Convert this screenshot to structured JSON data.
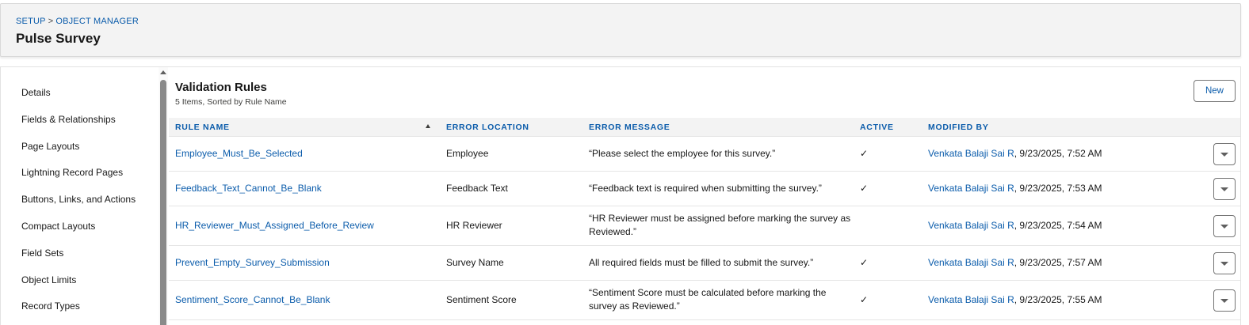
{
  "breadcrumb": {
    "setup": "SETUP",
    "separator": ">",
    "object_manager": "OBJECT MANAGER"
  },
  "page_title": "Pulse Survey",
  "sidebar": {
    "items": [
      {
        "label": "Details"
      },
      {
        "label": "Fields & Relationships"
      },
      {
        "label": "Page Layouts"
      },
      {
        "label": "Lightning Record Pages"
      },
      {
        "label": "Buttons, Links, and Actions"
      },
      {
        "label": "Compact Layouts"
      },
      {
        "label": "Field Sets"
      },
      {
        "label": "Object Limits"
      },
      {
        "label": "Record Types"
      }
    ]
  },
  "section": {
    "title": "Validation Rules",
    "subtitle": "5 Items, Sorted by Rule Name",
    "new_label": "New"
  },
  "table": {
    "columns": [
      "RULE NAME",
      "ERROR LOCATION",
      "ERROR MESSAGE",
      "ACTIVE",
      "MODIFIED BY"
    ],
    "rows": [
      {
        "rule_name": "Employee_Must_Be_Selected",
        "error_location": "Employee",
        "error_message": "“Please select the employee for this survey.”",
        "active": "✓",
        "modified_user": "Venkata Balaji Sai R",
        "modified_date": ", 9/23/2025, 7:52 AM"
      },
      {
        "rule_name": "Feedback_Text_Cannot_Be_Blank",
        "error_location": "Feedback Text",
        "error_message": "“Feedback text is required when submitting the survey.”",
        "active": "✓",
        "modified_user": "Venkata Balaji Sai R",
        "modified_date": ", 9/23/2025, 7:53 AM"
      },
      {
        "rule_name": "HR_Reviewer_Must_Assigned_Before_Review",
        "error_location": "HR Reviewer",
        "error_message": "“HR Reviewer must be assigned before marking the survey as Reviewed.”",
        "active": "",
        "modified_user": "Venkata Balaji Sai R",
        "modified_date": ", 9/23/2025, 7:54 AM"
      },
      {
        "rule_name": "Prevent_Empty_Survey_Submission",
        "error_location": "Survey Name",
        "error_message": "All required fields must be filled to submit the survey.”",
        "active": "✓",
        "modified_user": "Venkata Balaji Sai R",
        "modified_date": ", 9/23/2025, 7:57 AM"
      },
      {
        "rule_name": "Sentiment_Score_Cannot_Be_Blank",
        "error_location": "Sentiment Score",
        "error_message": "“Sentiment Score must be calculated before marking the survey as Reviewed.”",
        "active": "✓",
        "modified_user": "Venkata Balaji Sai R",
        "modified_date": ", 9/23/2025, 7:55 AM"
      }
    ]
  },
  "icons": {
    "sort": "sort-ascending-icon",
    "check": "checkmark-icon",
    "row_menu": "chevron-down-icon"
  },
  "colors": {
    "link": "#0b5cab",
    "header_bg": "#f3f3f3",
    "text": "#181818"
  }
}
